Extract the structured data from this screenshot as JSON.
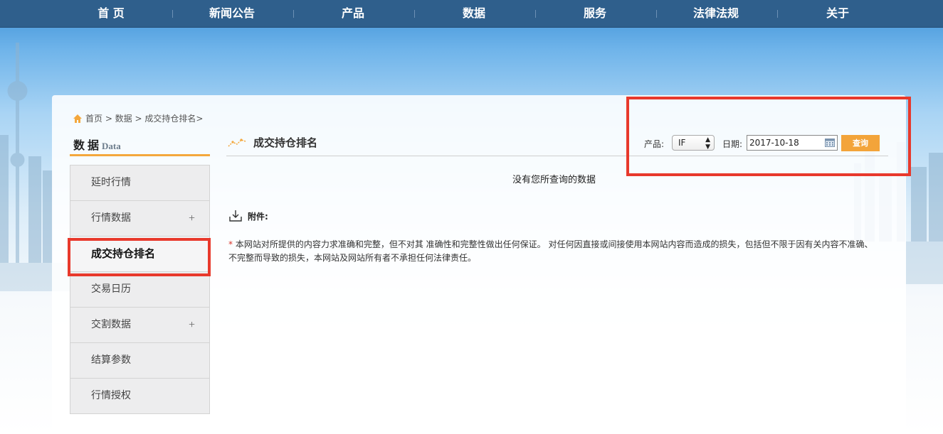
{
  "nav": {
    "items": [
      "首 页",
      "新闻公告",
      "产品",
      "数据",
      "服务",
      "法律法规",
      "关于"
    ]
  },
  "breadcrumb": {
    "text": "首页 > 数据 > 成交持仓排名>"
  },
  "sidebar": {
    "title": "数 据",
    "title_en": "Data",
    "items": [
      {
        "label": "延时行情",
        "expandable": false
      },
      {
        "label": "行情数据",
        "expandable": true,
        "plus": "+"
      },
      {
        "label": "成交持仓排名",
        "expandable": false,
        "active": true
      },
      {
        "label": "交易日历",
        "expandable": false
      },
      {
        "label": "交割数据",
        "expandable": true,
        "plus": "+"
      },
      {
        "label": "结算参数",
        "expandable": false
      },
      {
        "label": "行情授权",
        "expandable": false
      }
    ]
  },
  "content": {
    "title": "成交持仓排名",
    "product_label": "产品:",
    "product_value": "IF",
    "date_label": "日期:",
    "date_value": "2017-10-18",
    "query_button": "查询",
    "no_data": "没有您所查询的数据",
    "attachment_label": "附件:",
    "disclaimer_star": "*",
    "disclaimer_line1": " 本网站对所提供的内容力求准确和完整，但不对其 准确性和完整性做出任何保证。 对任何因直接或间接使用本网站内容而造成的损失，包括但不限于因有关内容不准确、",
    "disclaimer_line2": "不完整而导致的损失，本网站及网站所有者不承担任何法律责任。"
  },
  "colors": {
    "nav_bg": "#2f5f8c",
    "accent": "#f4a73c",
    "highlight_box": "#e8392c"
  }
}
